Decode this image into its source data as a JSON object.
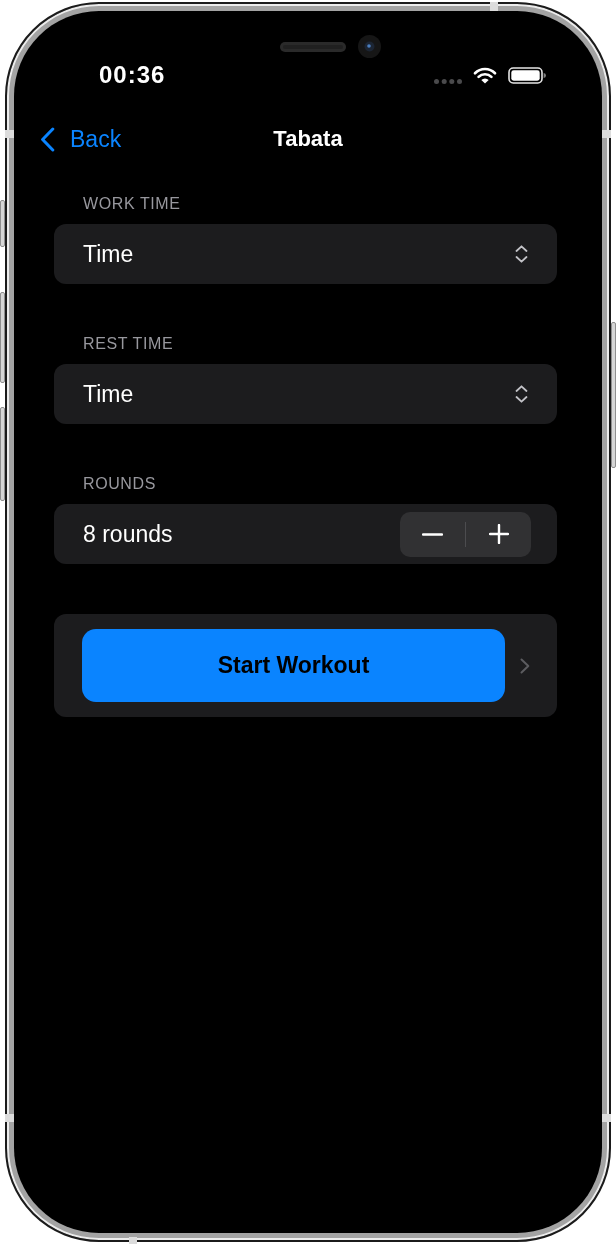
{
  "status_bar": {
    "time": "00:36"
  },
  "nav_bar": {
    "back_label": "Back",
    "title": "Tabata"
  },
  "sections": [
    {
      "header": "WORK TIME",
      "kind": "picker",
      "value": "Time"
    },
    {
      "header": "REST TIME",
      "kind": "picker",
      "value": "Time"
    },
    {
      "header": "ROUNDS",
      "kind": "stepper",
      "value": "8 rounds"
    }
  ],
  "start_button": {
    "label": "Start Workout"
  }
}
